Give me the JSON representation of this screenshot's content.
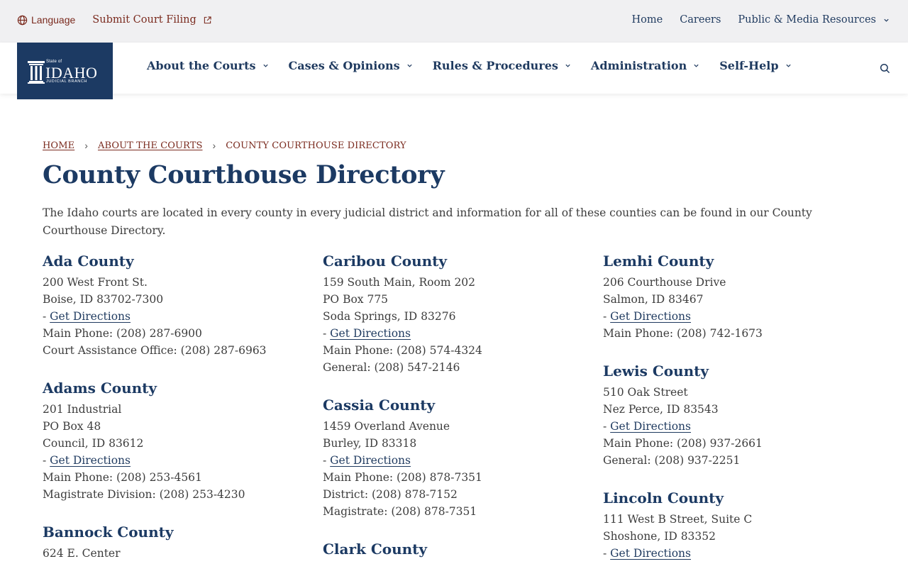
{
  "utility": {
    "language": "Language",
    "submit_filing": "Submit Court Filing",
    "links": [
      "Home",
      "Careers",
      "Public & Media Resources"
    ]
  },
  "logo": {
    "state_of": "State of",
    "idaho": "IDAHO",
    "branch": "JUDICIAL BRANCH"
  },
  "nav": [
    "About the Courts",
    "Cases & Opinions",
    "Rules & Procedures",
    "Administration",
    "Self-Help"
  ],
  "breadcrumb": [
    "HOME",
    "ABOUT THE COURTS",
    "COUNTY COURTHOUSE DIRECTORY"
  ],
  "page_title": "County Courthouse Directory",
  "intro": "The Idaho courts are located in every county in every judicial district and information for all of these counties can be found in our County Courthouse Directory.",
  "directions_prefix": "- ",
  "directions_label": "Get Directions",
  "columns": [
    [
      {
        "name": "Ada County",
        "address": [
          "200 West Front St.",
          "Boise, ID 83702-7300"
        ],
        "phones": [
          "Main Phone: (208) 287-6900",
          "Court Assistance Office: (208) 287-6963"
        ]
      },
      {
        "name": "Adams County",
        "address": [
          "201 Industrial",
          "PO Box 48",
          "Council, ID 83612"
        ],
        "phones": [
          "Main Phone: (208) 253-4561",
          "Magistrate Division: (208) 253-4230"
        ]
      },
      {
        "name": "Bannock County",
        "address": [
          "624 E. Center"
        ],
        "phones": []
      }
    ],
    [
      {
        "name": "Caribou County",
        "address": [
          "159 South Main, Room 202",
          "PO Box 775",
          "Soda Springs, ID 83276"
        ],
        "phones": [
          "Main Phone: (208) 574-4324",
          "General: (208) 547-2146"
        ]
      },
      {
        "name": "Cassia County",
        "address": [
          "1459 Overland Avenue",
          "Burley, ID 83318"
        ],
        "phones": [
          "Main Phone: (208) 878-7351",
          "District: (208) 878-7152",
          "Magistrate: (208) 878-7351"
        ]
      },
      {
        "name": "Clark County",
        "address": [],
        "phones": []
      }
    ],
    [
      {
        "name": "Lemhi County",
        "address": [
          "206 Courthouse Drive",
          "Salmon, ID 83467"
        ],
        "phones": [
          "Main Phone: (208) 742-1673"
        ]
      },
      {
        "name": "Lewis County",
        "address": [
          "510 Oak Street",
          "Nez Perce, ID 83543"
        ],
        "phones": [
          "Main Phone: (208) 937-2661",
          "General: (208) 937-2251"
        ]
      },
      {
        "name": "Lincoln County",
        "address": [
          "111 West B Street, Suite C",
          "Shoshone, ID 83352"
        ],
        "phones": []
      }
    ]
  ]
}
